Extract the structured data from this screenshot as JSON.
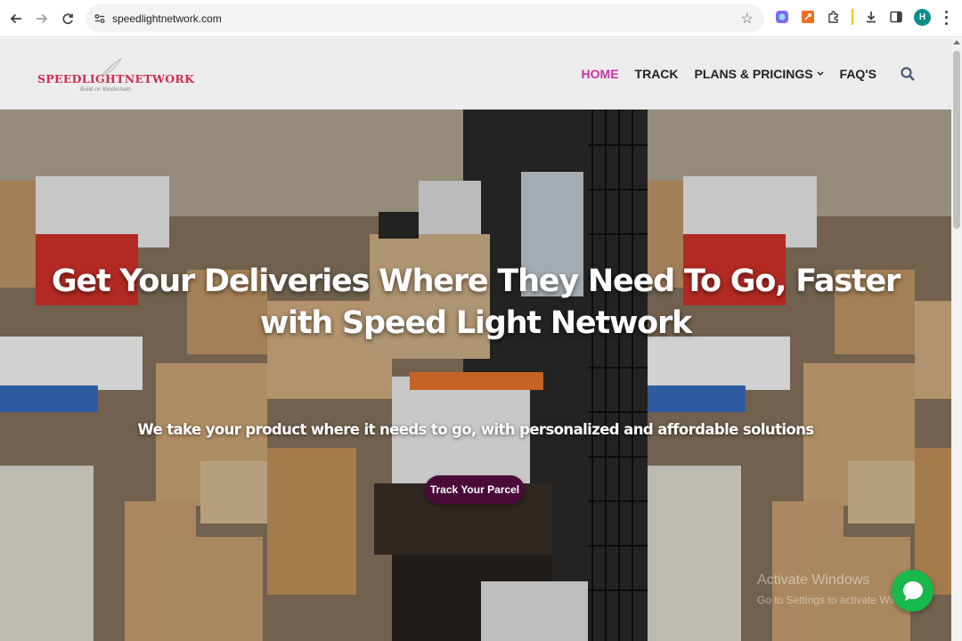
{
  "browser": {
    "url": "speedlightnetwork.com",
    "profile_initial": "H"
  },
  "site": {
    "logo_text": "SPEEDLIGHTNETWORK",
    "logo_tagline": "Build on Blockchain",
    "nav": [
      {
        "label": "HOME",
        "active": true
      },
      {
        "label": "TRACK"
      },
      {
        "label": "PLANS & PRICINGS",
        "dropdown": true
      },
      {
        "label": "FAQ'S"
      }
    ],
    "accent_color": "#c930a8"
  },
  "hero": {
    "title": "Get Your Deliveries Where They Need To Go, Faster with Speed Light Network",
    "subtitle": "We take your product where it needs to go, with personalized and affordable solutions",
    "cta_label": "Track Your Parcel",
    "cta_color": "#4a0b3b"
  },
  "overlay": {
    "windows_watermark_line1": "Activate Windows",
    "windows_watermark_line2": "Go to Settings to activate Windows."
  }
}
